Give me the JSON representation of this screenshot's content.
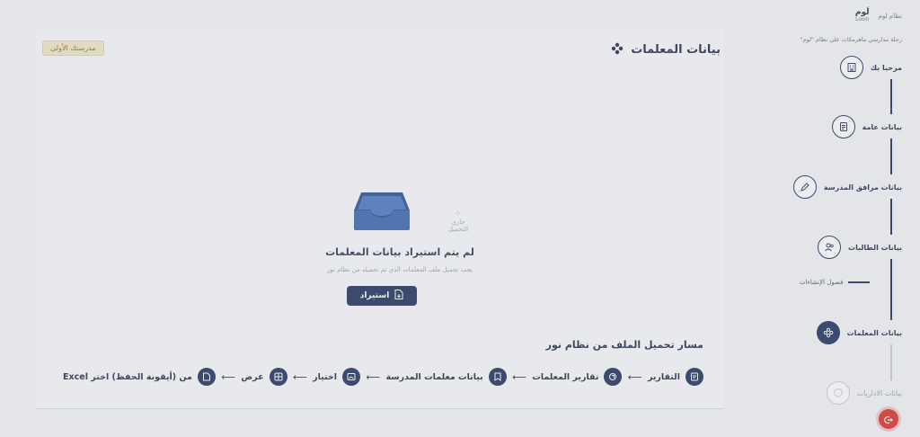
{
  "brand": {
    "logo_ar": "لَوم",
    "logo_en": "Loom",
    "system_label": "نظام لوم"
  },
  "breadcrumb": {
    "text": "رحلة مدارسي ماهرمكات على نظام \"لوم\""
  },
  "header": {
    "title": "بيانات المعلمات",
    "school_badge": "مدرستك الأولى"
  },
  "empty_state": {
    "loader_text": "جاري التحميل",
    "title": "لم يتم استيراد بيانات المعلمات",
    "subtitle": "يجب تحميل ملف المعلمات الذي تم تحميله من نظام نور",
    "import_label": "استيراد"
  },
  "upload_path": {
    "title": "مسار تحميل الملف من نظام نور",
    "arrow": "⟵",
    "steps": [
      {
        "label": "التقارير",
        "icon": "report-icon"
      },
      {
        "label": "تقارير المعلمات",
        "icon": "copy-icon"
      },
      {
        "label": "بيانات معلمات المدرسة",
        "icon": "id-badge-icon"
      },
      {
        "label": "اختيار",
        "icon": "image-icon"
      },
      {
        "label": "عرض",
        "icon": "grid-icon"
      },
      {
        "label": "من (أيقونة الحفظ) اختر Excel",
        "icon": "file-icon"
      }
    ]
  },
  "sidebar": {
    "items": [
      {
        "label": "مرحبا بك",
        "icon": "building-icon"
      },
      {
        "label": "بيانات عامة",
        "icon": "document-icon"
      },
      {
        "label": "بيانات مرافق المدرسة",
        "icon": "pencil-icon"
      },
      {
        "label": "بيانات الطالبات",
        "icon": "users-icon"
      },
      {
        "label": "بيانات المعلمات",
        "icon": "network-icon"
      },
      {
        "label": "بيانات الاداريات",
        "icon": "shield-icon"
      }
    ],
    "sub_item": "فصول الإنشاءات"
  },
  "colors": {
    "primary": "#1d2f5a",
    "logout": "#d9302c",
    "badge_bg": "#f2e7c4"
  }
}
